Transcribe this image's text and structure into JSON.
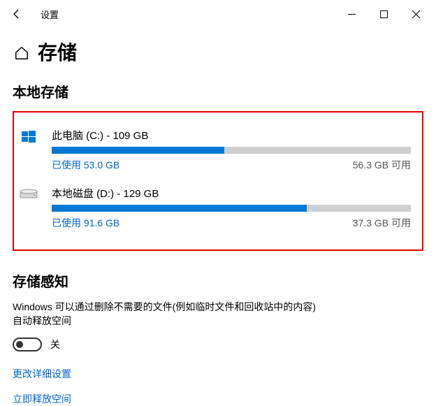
{
  "window": {
    "title": "设置"
  },
  "page": {
    "title": "存储",
    "section_local_storage": "本地存储",
    "section_sense": "存储感知",
    "sense_desc_line1": "Windows 可以通过删除不需要的文件(例如临时文件和回收站中的内容)",
    "sense_desc_line2": "自动释放空间",
    "toggle_off_label": "关",
    "link_details": "更改详细设置",
    "link_free_now": "立即释放空间"
  },
  "drives": [
    {
      "icon": "windows",
      "label": "此电脑 (C:) - 109 GB",
      "used_text": "已使用 53.0 GB",
      "free_text": "56.3 GB 可用",
      "used_pct": 48
    },
    {
      "icon": "disk",
      "label": "本地磁盘 (D:) - 129 GB",
      "used_text": "已使用 91.6 GB",
      "free_text": "37.3 GB 可用",
      "used_pct": 71
    }
  ]
}
